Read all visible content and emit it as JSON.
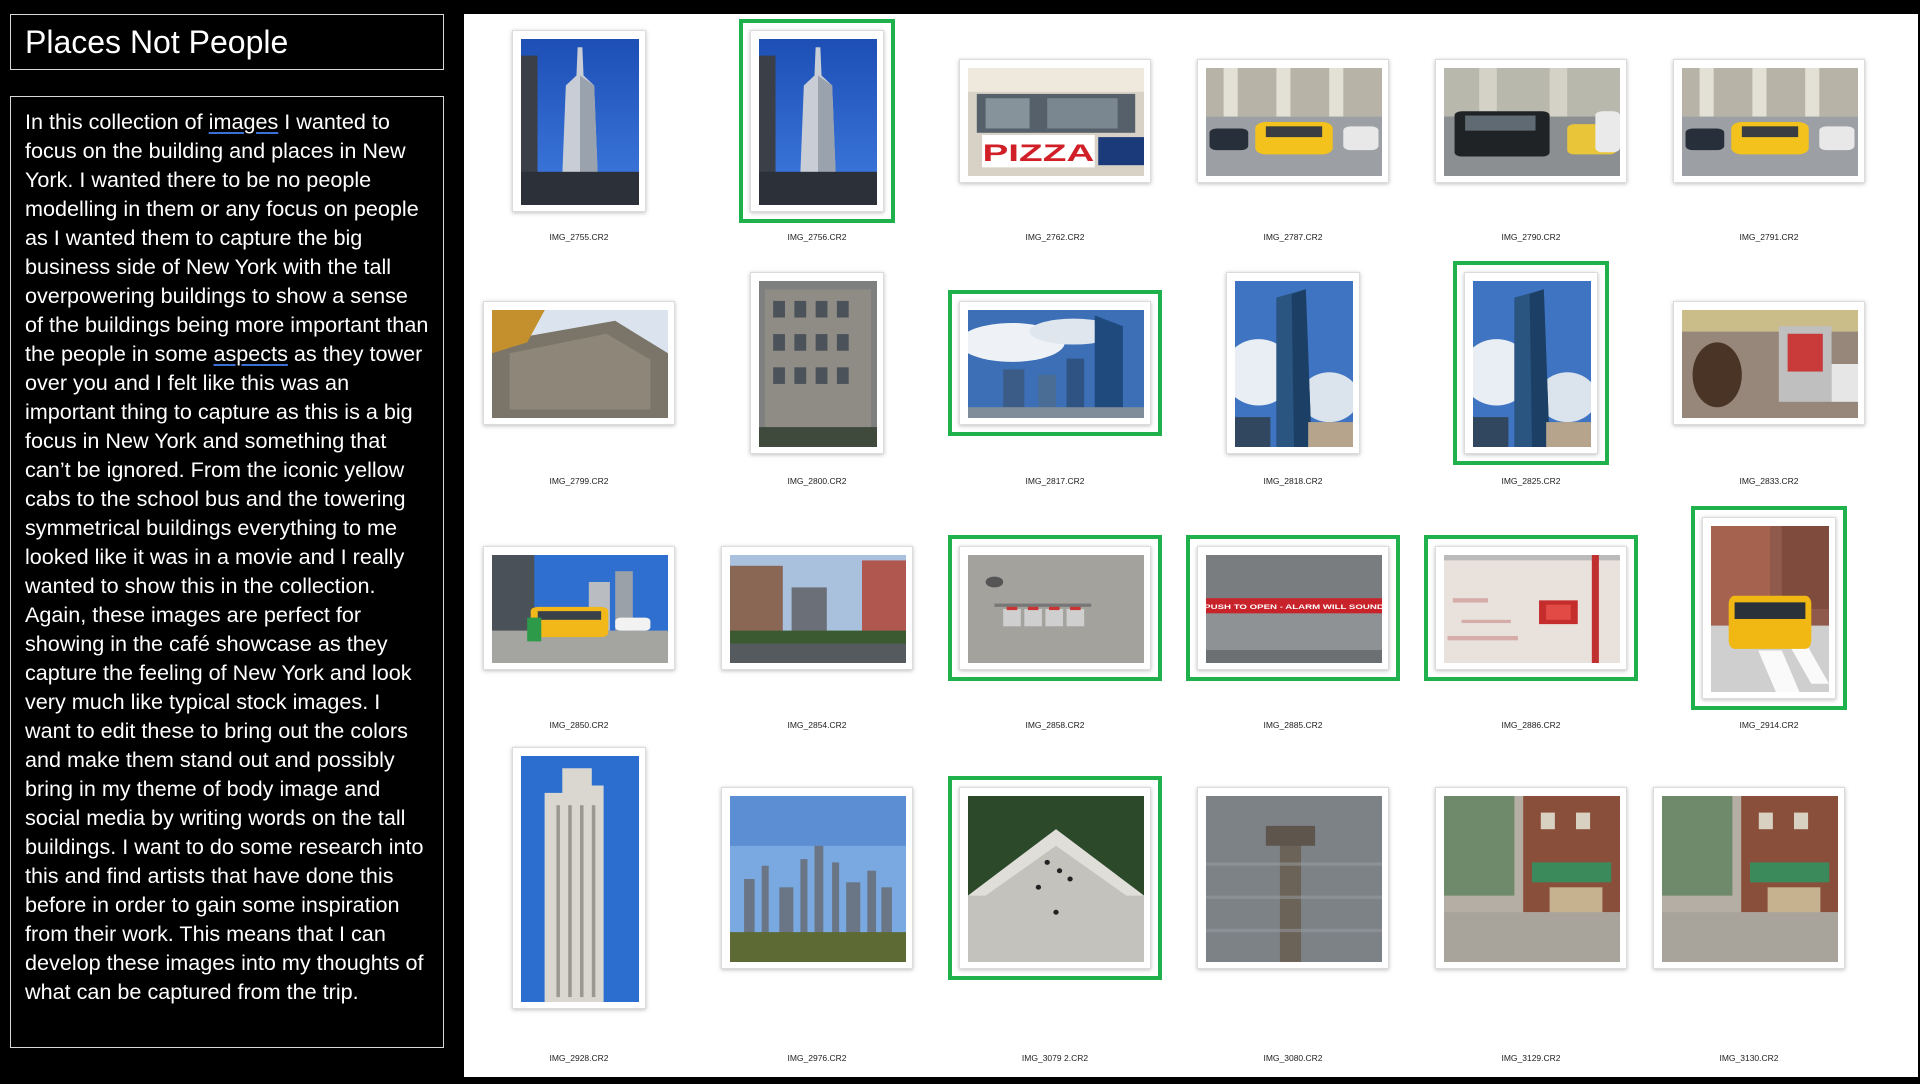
{
  "title": "Places Not People",
  "description": {
    "before_link1": "In this collection of ",
    "link1": "images",
    "mid": " I wanted to focus on the building and places in New York. I wanted there to be no people modelling in them or any focus on people as I wanted them to capture the big business side of New York with the tall overpowering buildings to show a sense of the buildings being more important than the people in some ",
    "link2": "aspects",
    "after_link2": " as they tower over you and I felt like this was an important thing to capture as this is a big focus in New York and something that can’t be ignored. From the iconic yellow cabs to the school bus and the towering symmetrical buildings everything to me looked like it was in a movie and I really wanted to show this in the collection. Again, these images are perfect for showing in the café showcase as they capture the feeling of New York and look very much like typical stock images. I want to edit these to bring out the colors and make them stand out and possibly bring in my theme of body image and social media by writing words on the tall buildings. I want to do some research into this and find artists that have done this before in order to gain some inspiration from their work. This means that I can develop these images into my thoughts of what can be captured from the trip."
  },
  "colors": {
    "selection": "#1fb14c",
    "background": "#000000",
    "gallery": "#ffffff"
  },
  "photos": [
    {
      "name": "IMG_2755.CR2",
      "selected": false,
      "scene": "tower"
    },
    {
      "name": "IMG_2756.CR2",
      "selected": true,
      "scene": "tower"
    },
    {
      "name": "IMG_2762.CR2",
      "selected": false,
      "scene": "pizza"
    },
    {
      "name": "IMG_2787.CR2",
      "selected": false,
      "scene": "taxi"
    },
    {
      "name": "IMG_2790.CR2",
      "selected": false,
      "scene": "jeep"
    },
    {
      "name": "IMG_2791.CR2",
      "selected": false,
      "scene": "taxi"
    },
    {
      "name": "IMG_2799.CR2",
      "selected": false,
      "scene": "building-angle"
    },
    {
      "name": "IMG_2800.CR2",
      "selected": false,
      "scene": "building"
    },
    {
      "name": "IMG_2817.CR2",
      "selected": true,
      "scene": "skyline-cloud"
    },
    {
      "name": "IMG_2818.CR2",
      "selected": false,
      "scene": "glass-tower"
    },
    {
      "name": "IMG_2825.CR2",
      "selected": true,
      "scene": "glass-tower"
    },
    {
      "name": "IMG_2833.CR2",
      "selected": false,
      "scene": "street-booth"
    },
    {
      "name": "IMG_2850.CR2",
      "selected": false,
      "scene": "schoolbus-street"
    },
    {
      "name": "IMG_2854.CR2",
      "selected": false,
      "scene": "highline"
    },
    {
      "name": "IMG_2858.CR2",
      "selected": true,
      "scene": "concrete-meters"
    },
    {
      "name": "IMG_2885.CR2",
      "selected": true,
      "scene": "alarm-sign",
      "sign_text": "PUSH TO OPEN - ALARM WILL SOUND"
    },
    {
      "name": "IMG_2886.CR2",
      "selected": true,
      "scene": "red-wall"
    },
    {
      "name": "IMG_2914.CR2",
      "selected": true,
      "scene": "schoolbus"
    },
    {
      "name": "IMG_2928.CR2",
      "selected": false,
      "scene": "tall-tower"
    },
    {
      "name": "IMG_2976.CR2",
      "selected": false,
      "scene": "park-skyline"
    },
    {
      "name": "IMG_3079 2.CR2",
      "selected": true,
      "scene": "plaza-aerial"
    },
    {
      "name": "IMG_3080.CR2",
      "selected": false,
      "scene": "pier"
    },
    {
      "name": "IMG_3129.CR2",
      "selected": false,
      "scene": "shop-street"
    },
    {
      "name": "IMG_3130.CR2",
      "selected": false,
      "scene": "shop-street"
    }
  ]
}
